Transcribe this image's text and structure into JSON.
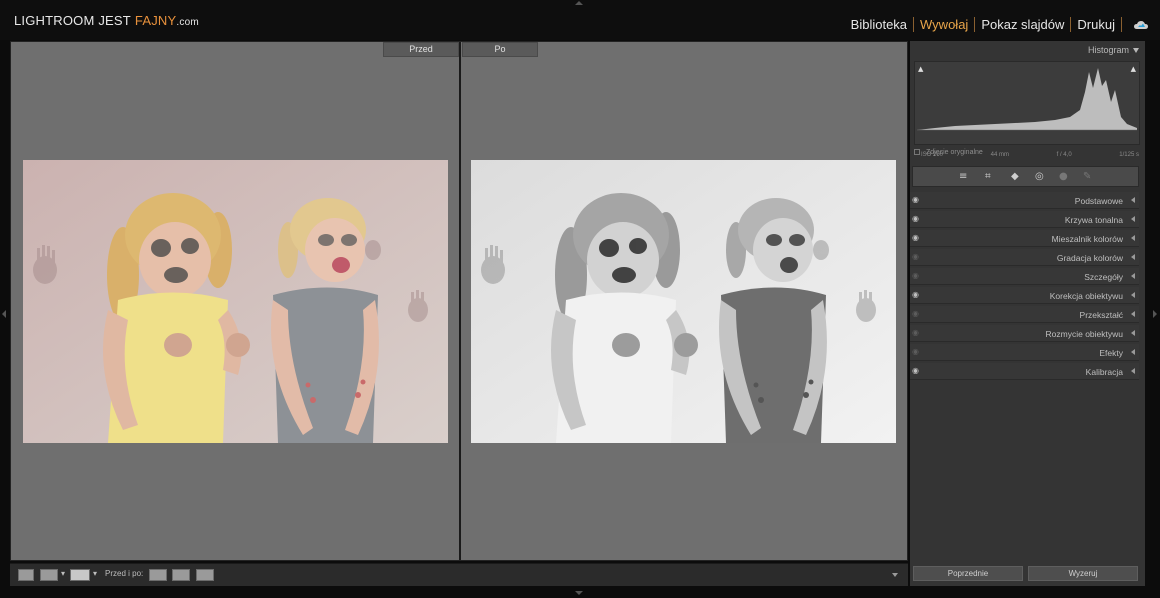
{
  "brand": {
    "part1": "LIGHTROOM JEST",
    "part2": "FAJNY",
    "part3": ".com"
  },
  "modules": [
    {
      "label": "Biblioteka",
      "active": false
    },
    {
      "label": "Wywołaj",
      "active": true
    },
    {
      "label": "Pokaz slajdów",
      "active": false
    },
    {
      "label": "Drukuj",
      "active": false
    }
  ],
  "cloud_icon": "cloud-icon",
  "view": {
    "before_label": "Przed",
    "after_label": "Po"
  },
  "toolbar": {
    "before_after_label": "Przed i po:"
  },
  "histogram": {
    "title": "Histogram",
    "info": [
      "ISO 200",
      "44 mm",
      "f / 4,0",
      "1/125 s"
    ],
    "original_photo_label": "Zdjęcie oryginalne"
  },
  "tools": [
    "sliders-icon",
    "crop-icon",
    "spot-removal-icon",
    "red-eye-icon",
    "radial-filter-icon",
    "brush-icon"
  ],
  "panels": [
    {
      "label": "Podstawowe",
      "visible": true
    },
    {
      "label": "Krzywa tonalna",
      "visible": true
    },
    {
      "label": "Mieszalnik kolorów",
      "visible": true
    },
    {
      "label": "Gradacja kolorów",
      "visible": false
    },
    {
      "label": "Szczegóły",
      "visible": false
    },
    {
      "label": "Korekcja obiektywu",
      "visible": true
    },
    {
      "label": "Przekształć",
      "visible": false
    },
    {
      "label": "Rozmycie obiektywu",
      "visible": false
    },
    {
      "label": "Efekty",
      "visible": false
    },
    {
      "label": "Kalibracja",
      "visible": true
    }
  ],
  "buttons": {
    "previous": "Poprzednie",
    "reset": "Wyzeruj"
  }
}
